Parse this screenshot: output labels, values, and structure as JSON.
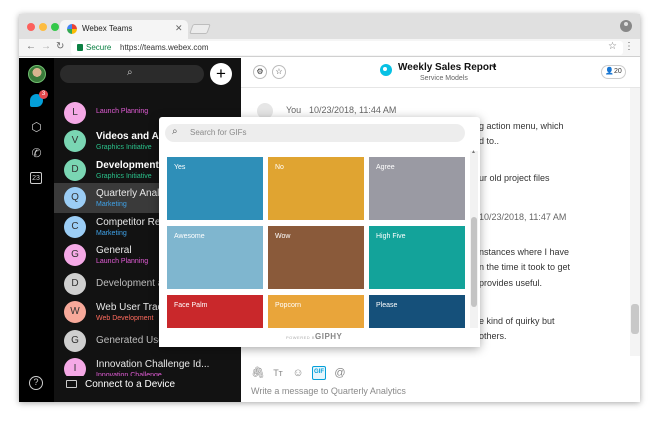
{
  "browser": {
    "tab_title": "Webex Teams",
    "secure_label": "Secure",
    "url": "https://teams.webex.com"
  },
  "rail": {
    "badge_count": "3",
    "help_glyph": "?"
  },
  "spaces": {
    "items": [
      {
        "initial": "L",
        "name": "",
        "subtitle": "Launch Planning",
        "sub_color": "#e45dd8",
        "av_color": "#f5a9e6",
        "style": "normal"
      },
      {
        "initial": "V",
        "name": "Videos and Animations",
        "subtitle": "Graphics Initiative",
        "sub_color": "#2ac08a",
        "av_color": "#7ad6b3",
        "style": "bold"
      },
      {
        "initial": "D",
        "name": "Development A",
        "subtitle": "Graphics Initiative",
        "sub_color": "#2ac08a",
        "av_color": "#7ad6b3",
        "style": "bold"
      },
      {
        "initial": "Q",
        "name": "Quarterly Analy",
        "subtitle": "Marketing",
        "sub_color": "#3fa2e8",
        "av_color": "#9bcdf5",
        "style": "selected"
      },
      {
        "initial": "C",
        "name": "Competitor Re",
        "subtitle": "Marketing",
        "sub_color": "#3fa2e8",
        "av_color": "#9bcdf5",
        "style": "normal"
      },
      {
        "initial": "G",
        "name": "General",
        "subtitle": "Launch Planning",
        "sub_color": "#e45dd8",
        "av_color": "#f5a9e6",
        "style": "normal"
      },
      {
        "initial": "D",
        "name": "Development a",
        "subtitle": "",
        "sub_color": "#888888",
        "av_color": "#cfcfcf",
        "style": "dim"
      },
      {
        "initial": "W",
        "name": "Web User Trac",
        "subtitle": "Web Development",
        "sub_color": "#ff6b5e",
        "av_color": "#f7a99a",
        "style": "normal"
      },
      {
        "initial": "G",
        "name": "Generated Use",
        "subtitle": "",
        "sub_color": "#888888",
        "av_color": "#cfcfcf",
        "style": "dim"
      },
      {
        "initial": "I",
        "name": "Innovation Challenge Id...",
        "subtitle": "Innovation Challenge",
        "sub_color": "#e45dd8",
        "av_color": "#f5a9e6",
        "style": "normal"
      }
    ],
    "connect_label": "Connect to a Device"
  },
  "header": {
    "space_title": "Weekly Sales Report",
    "space_subtitle": "Service Models",
    "people_count": "20"
  },
  "messages": {
    "author": "You",
    "timestamp": "10/23/2018, 11:44 AM",
    "lines": [
      "g action menu, which",
      "d to..",
      "ur old project files",
      "10/23/2018, 11:47 AM",
      "nstances where I have",
      "n the time it took to get",
      "provides useful.",
      "e kind of quirky but",
      "others."
    ]
  },
  "composer": {
    "placeholder": "Write a message to Quarterly Analytics",
    "gif_button_label": "GIF"
  },
  "gif_picker": {
    "search_placeholder": "Search for GIFs",
    "tiles": [
      {
        "label": "Yes",
        "color": "#2f8fb8"
      },
      {
        "label": "No",
        "color": "#e0a431"
      },
      {
        "label": "Agree",
        "color": "#9a9aa3"
      },
      {
        "label": "Awesome",
        "color": "#7fb6cf"
      },
      {
        "label": "Wow",
        "color": "#8a5a3a"
      },
      {
        "label": "High Five",
        "color": "#13a39a"
      },
      {
        "label": "Face Palm",
        "color": "#c9282b"
      },
      {
        "label": "Popcorn",
        "color": "#e9a53a"
      },
      {
        "label": "Please",
        "color": "#15507a"
      }
    ],
    "powered_by": "POWERED BY",
    "brand": "GIPHY"
  }
}
